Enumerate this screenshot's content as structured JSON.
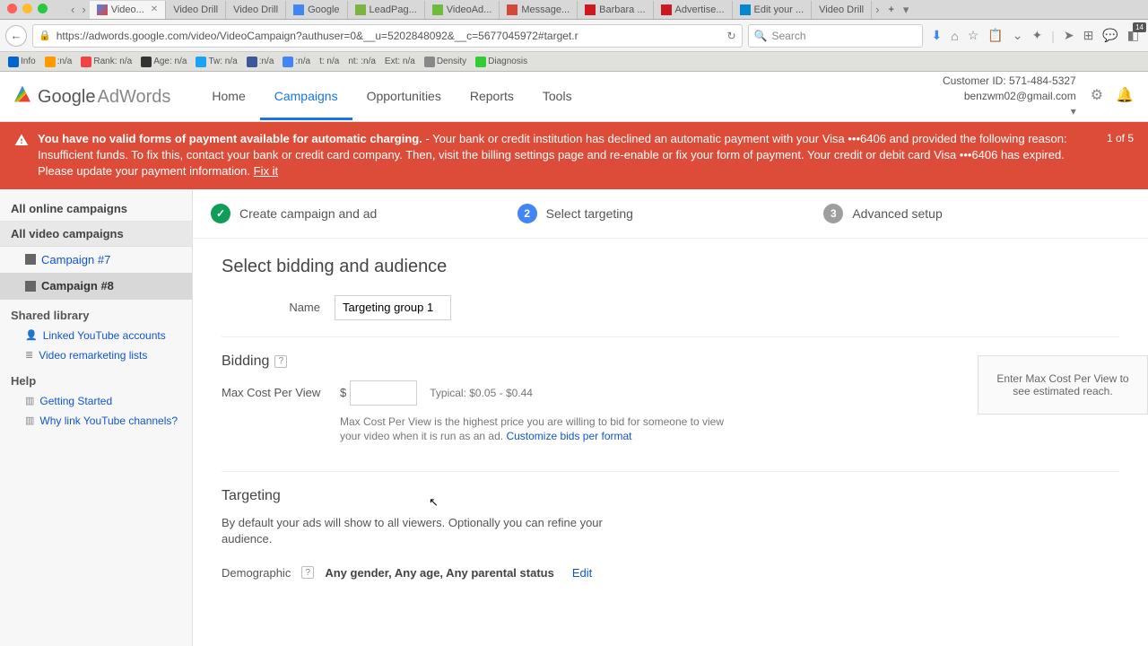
{
  "macControls": {},
  "tabs": {
    "items": [
      {
        "label": "Video..."
      },
      {
        "label": "Video Drill"
      },
      {
        "label": "Video Drill"
      },
      {
        "label": "Google"
      },
      {
        "label": "LeadPag..."
      },
      {
        "label": "VideoAd..."
      },
      {
        "label": "Message..."
      },
      {
        "label": "Barbara ..."
      },
      {
        "label": "Advertise..."
      },
      {
        "label": "Edit your ..."
      },
      {
        "label": "Video Drill"
      }
    ]
  },
  "url": "https://adwords.google.com/video/VideoCampaign?authuser=0&__u=5202848092&__c=5677045972#target.r",
  "searchPlaceholder": "Search",
  "bookmarks": [
    {
      "label": "Info"
    },
    {
      "label": " :n/a"
    },
    {
      "label": "Rank: n/a"
    },
    {
      "label": "Age: n/a"
    },
    {
      "label": "Tw: n/a"
    },
    {
      "label": " :n/a"
    },
    {
      "label": " :n/a"
    },
    {
      "label": "t: n/a"
    },
    {
      "label": "nt: :n/a"
    },
    {
      "label": "Ext: n/a"
    },
    {
      "label": "Density"
    },
    {
      "label": "Diagnosis"
    }
  ],
  "logo": {
    "google": "Google",
    "adwords": "AdWords"
  },
  "nav": {
    "home": "Home",
    "campaigns": "Campaigns",
    "opportunities": "Opportunities",
    "reports": "Reports",
    "tools": "Tools"
  },
  "account": {
    "id": "Customer ID: 571-484-5327",
    "email": "benzwm02@gmail.com"
  },
  "alert": {
    "bold": "You have no valid forms of payment available for automatic charging.",
    "rest": " - Your bank or credit institution has declined an automatic payment with your Visa •••6406 and provided the following reason: Insufficient funds. To fix this, contact your bank or credit card company. Then, visit the billing settings page and re-enable or fix your form of payment. Your credit or debit card Visa •••6406 has expired. Please update your payment information. ",
    "fix": "Fix it",
    "count": "1 of 5"
  },
  "sidebar": {
    "online": "All online campaigns",
    "video": "All video campaigns",
    "items": [
      {
        "label": "Campaign #7"
      },
      {
        "label": "Campaign #8"
      }
    ],
    "shared": "Shared library",
    "sharedItems": [
      {
        "label": "Linked YouTube accounts"
      },
      {
        "label": "Video remarketing lists"
      }
    ],
    "help": "Help",
    "helpItems": [
      {
        "label": "Getting Started"
      },
      {
        "label": "Why link YouTube channels?"
      }
    ]
  },
  "stepper": {
    "s1": "Create campaign and ad",
    "s2": "Select targeting",
    "s3": "Advanced setup"
  },
  "content": {
    "title": "Select bidding and audience",
    "nameLabel": "Name",
    "nameValue": "Targeting group 1",
    "biddingTitle": "Bidding",
    "maxCpvLabel": "Max Cost Per View",
    "typical": "Typical: $0.05 - $0.44",
    "cpvHelp": "Max Cost Per View is the highest price you are willing to bid for someone to view your video when it is run as an ad. ",
    "customize": "Customize bids per format",
    "targetingTitle": "Targeting",
    "targetingDesc": "By default your ads will show to all viewers. Optionally you can refine your audience.",
    "demoLabel": "Demographic",
    "demoValue": "Any gender, Any age, Any parental status",
    "edit": "Edit"
  },
  "reachBox": "Enter Max Cost Per View to see estimated reach."
}
